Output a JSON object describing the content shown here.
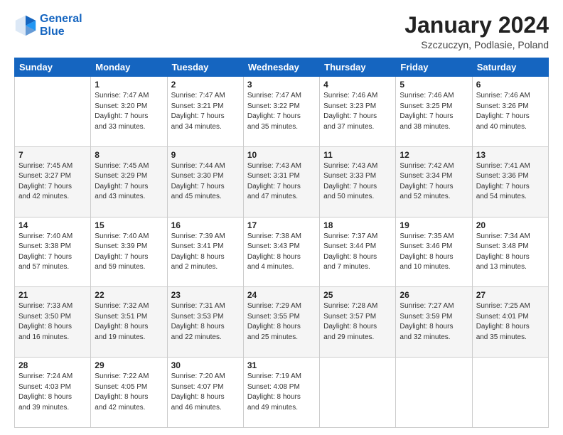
{
  "header": {
    "logo": {
      "line1": "General",
      "line2": "Blue"
    },
    "title": "January 2024",
    "subtitle": "Szczuczyn, Podlasie, Poland"
  },
  "weekdays": [
    "Sunday",
    "Monday",
    "Tuesday",
    "Wednesday",
    "Thursday",
    "Friday",
    "Saturday"
  ],
  "weeks": [
    [
      {
        "day": "",
        "info": ""
      },
      {
        "day": "1",
        "info": "Sunrise: 7:47 AM\nSunset: 3:20 PM\nDaylight: 7 hours\nand 33 minutes."
      },
      {
        "day": "2",
        "info": "Sunrise: 7:47 AM\nSunset: 3:21 PM\nDaylight: 7 hours\nand 34 minutes."
      },
      {
        "day": "3",
        "info": "Sunrise: 7:47 AM\nSunset: 3:22 PM\nDaylight: 7 hours\nand 35 minutes."
      },
      {
        "day": "4",
        "info": "Sunrise: 7:46 AM\nSunset: 3:23 PM\nDaylight: 7 hours\nand 37 minutes."
      },
      {
        "day": "5",
        "info": "Sunrise: 7:46 AM\nSunset: 3:25 PM\nDaylight: 7 hours\nand 38 minutes."
      },
      {
        "day": "6",
        "info": "Sunrise: 7:46 AM\nSunset: 3:26 PM\nDaylight: 7 hours\nand 40 minutes."
      }
    ],
    [
      {
        "day": "7",
        "info": "Sunrise: 7:45 AM\nSunset: 3:27 PM\nDaylight: 7 hours\nand 42 minutes."
      },
      {
        "day": "8",
        "info": "Sunrise: 7:45 AM\nSunset: 3:29 PM\nDaylight: 7 hours\nand 43 minutes."
      },
      {
        "day": "9",
        "info": "Sunrise: 7:44 AM\nSunset: 3:30 PM\nDaylight: 7 hours\nand 45 minutes."
      },
      {
        "day": "10",
        "info": "Sunrise: 7:43 AM\nSunset: 3:31 PM\nDaylight: 7 hours\nand 47 minutes."
      },
      {
        "day": "11",
        "info": "Sunrise: 7:43 AM\nSunset: 3:33 PM\nDaylight: 7 hours\nand 50 minutes."
      },
      {
        "day": "12",
        "info": "Sunrise: 7:42 AM\nSunset: 3:34 PM\nDaylight: 7 hours\nand 52 minutes."
      },
      {
        "day": "13",
        "info": "Sunrise: 7:41 AM\nSunset: 3:36 PM\nDaylight: 7 hours\nand 54 minutes."
      }
    ],
    [
      {
        "day": "14",
        "info": "Sunrise: 7:40 AM\nSunset: 3:38 PM\nDaylight: 7 hours\nand 57 minutes."
      },
      {
        "day": "15",
        "info": "Sunrise: 7:40 AM\nSunset: 3:39 PM\nDaylight: 7 hours\nand 59 minutes."
      },
      {
        "day": "16",
        "info": "Sunrise: 7:39 AM\nSunset: 3:41 PM\nDaylight: 8 hours\nand 2 minutes."
      },
      {
        "day": "17",
        "info": "Sunrise: 7:38 AM\nSunset: 3:43 PM\nDaylight: 8 hours\nand 4 minutes."
      },
      {
        "day": "18",
        "info": "Sunrise: 7:37 AM\nSunset: 3:44 PM\nDaylight: 8 hours\nand 7 minutes."
      },
      {
        "day": "19",
        "info": "Sunrise: 7:35 AM\nSunset: 3:46 PM\nDaylight: 8 hours\nand 10 minutes."
      },
      {
        "day": "20",
        "info": "Sunrise: 7:34 AM\nSunset: 3:48 PM\nDaylight: 8 hours\nand 13 minutes."
      }
    ],
    [
      {
        "day": "21",
        "info": "Sunrise: 7:33 AM\nSunset: 3:50 PM\nDaylight: 8 hours\nand 16 minutes."
      },
      {
        "day": "22",
        "info": "Sunrise: 7:32 AM\nSunset: 3:51 PM\nDaylight: 8 hours\nand 19 minutes."
      },
      {
        "day": "23",
        "info": "Sunrise: 7:31 AM\nSunset: 3:53 PM\nDaylight: 8 hours\nand 22 minutes."
      },
      {
        "day": "24",
        "info": "Sunrise: 7:29 AM\nSunset: 3:55 PM\nDaylight: 8 hours\nand 25 minutes."
      },
      {
        "day": "25",
        "info": "Sunrise: 7:28 AM\nSunset: 3:57 PM\nDaylight: 8 hours\nand 29 minutes."
      },
      {
        "day": "26",
        "info": "Sunrise: 7:27 AM\nSunset: 3:59 PM\nDaylight: 8 hours\nand 32 minutes."
      },
      {
        "day": "27",
        "info": "Sunrise: 7:25 AM\nSunset: 4:01 PM\nDaylight: 8 hours\nand 35 minutes."
      }
    ],
    [
      {
        "day": "28",
        "info": "Sunrise: 7:24 AM\nSunset: 4:03 PM\nDaylight: 8 hours\nand 39 minutes."
      },
      {
        "day": "29",
        "info": "Sunrise: 7:22 AM\nSunset: 4:05 PM\nDaylight: 8 hours\nand 42 minutes."
      },
      {
        "day": "30",
        "info": "Sunrise: 7:20 AM\nSunset: 4:07 PM\nDaylight: 8 hours\nand 46 minutes."
      },
      {
        "day": "31",
        "info": "Sunrise: 7:19 AM\nSunset: 4:08 PM\nDaylight: 8 hours\nand 49 minutes."
      },
      {
        "day": "",
        "info": ""
      },
      {
        "day": "",
        "info": ""
      },
      {
        "day": "",
        "info": ""
      }
    ]
  ]
}
